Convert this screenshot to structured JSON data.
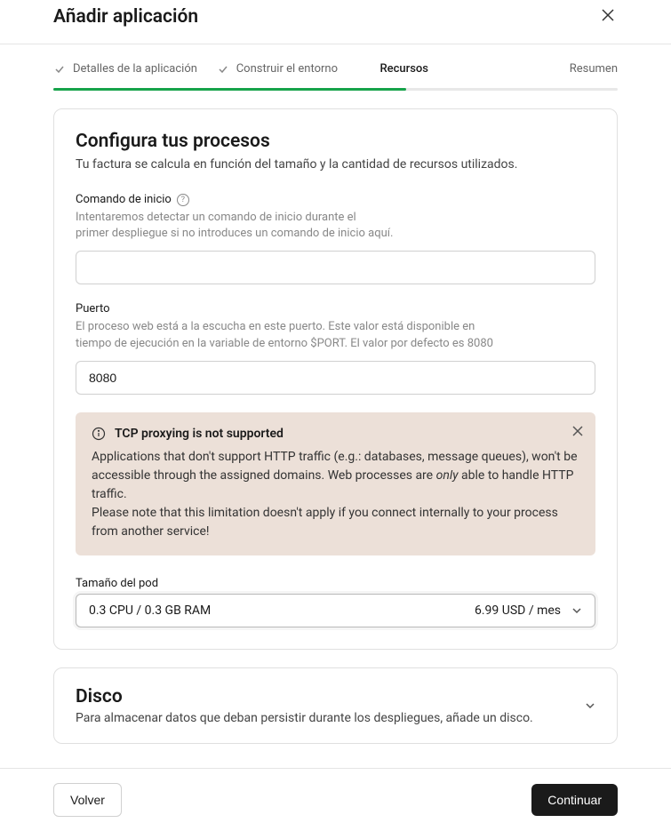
{
  "header": {
    "title": "Añadir aplicación"
  },
  "steps": {
    "step1": "Detalles de la aplicación",
    "step2": "Construir el entorno",
    "step3": "Recursos",
    "step4": "Resumen"
  },
  "processes": {
    "title": "Configura tus procesos",
    "subtitle": "Tu factura se calcula en función del tamaño y la cantidad de recursos utilizados."
  },
  "start_command": {
    "label": "Comando de inicio",
    "hint1": "Intentaremos detectar un comando de inicio durante el",
    "hint2": "primer despliegue si no introduces un comando de inicio aquí.",
    "value": ""
  },
  "port": {
    "label": "Puerto",
    "hint1": "El proceso web está a la escucha en este puerto. Este valor está disponible en",
    "hint2": "tiempo de ejecución en la variable de entorno $PORT. El valor por defecto es 8080",
    "value": "8080"
  },
  "alert": {
    "title": "TCP proxying is not supported",
    "body1_a": "Applications that don't support HTTP traffic (e.g.: databases, message queues), won't be accessible through the assigned domains. Web processes are ",
    "body1_only": "only",
    "body1_b": " able to handle HTTP traffic.",
    "body2": "Please note that this limitation doesn't apply if you connect internally to your process from another service!"
  },
  "pod_size": {
    "label": "Tamaño del pod",
    "selected_spec": "0.3 CPU / 0.3 GB RAM",
    "selected_price": "6.99 USD / mes"
  },
  "disk": {
    "title": "Disco",
    "subtitle": "Para almacenar datos que deban persistir durante los despliegues, añade un disco."
  },
  "footer": {
    "back": "Volver",
    "continue": "Continuar"
  }
}
